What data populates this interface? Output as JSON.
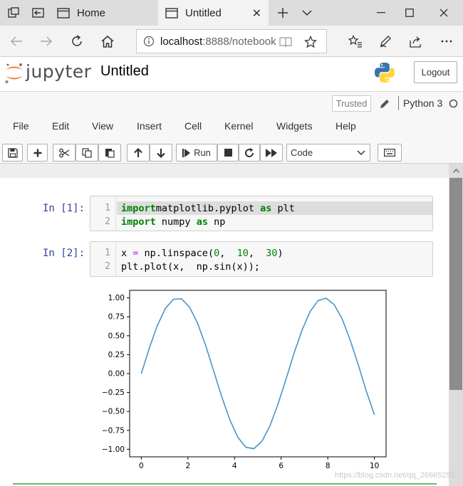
{
  "browser": {
    "tabs": [
      {
        "label": "Home",
        "active": false
      },
      {
        "label": "Untitled",
        "active": true
      }
    ],
    "address": {
      "host": "localhost",
      "path": ":8888/notebook"
    }
  },
  "jupyter": {
    "logo_text": "jupyter",
    "notebook_title": "Untitled",
    "logout_label": "Logout",
    "trusted_label": "Trusted",
    "kernel_label": "Python 3",
    "menu": [
      "File",
      "Edit",
      "View",
      "Insert",
      "Cell",
      "Kernel",
      "Widgets",
      "Help"
    ],
    "toolbar": {
      "run_label": "Run",
      "cell_type": "Code"
    }
  },
  "cells": [
    {
      "prompt": "In  [1]:",
      "lines": [
        {
          "n": "1",
          "tokens": [
            [
              "kw",
              "import"
            ],
            [
              "",
              "matplotlib.pyplot "
            ],
            [
              "kw",
              "as"
            ],
            [
              "",
              " plt"
            ]
          ]
        },
        {
          "n": "2",
          "tokens": [
            [
              "kw",
              "import"
            ],
            [
              "",
              " numpy "
            ],
            [
              "kw",
              "as"
            ],
            [
              "",
              " np"
            ]
          ]
        }
      ]
    },
    {
      "prompt": "In  [2]:",
      "lines": [
        {
          "n": "1",
          "tokens": [
            [
              "",
              "x "
            ],
            [
              "op",
              "="
            ],
            [
              "",
              " np.linspace("
            ],
            [
              "num",
              "0"
            ],
            [
              "",
              ",  "
            ],
            [
              "num",
              "10"
            ],
            [
              "",
              ",  "
            ],
            [
              "num",
              "30"
            ],
            [
              "",
              ")"
            ]
          ]
        },
        {
          "n": "2",
          "tokens": [
            [
              "",
              "plt.plot(x,  np.sin(x));"
            ]
          ]
        }
      ]
    }
  ],
  "chart_data": {
    "type": "line",
    "x": [
      0,
      0.345,
      0.69,
      1.034,
      1.379,
      1.724,
      2.069,
      2.414,
      2.759,
      3.103,
      3.448,
      3.793,
      4.138,
      4.483,
      4.828,
      5.172,
      5.517,
      5.862,
      6.207,
      6.552,
      6.897,
      7.241,
      7.586,
      7.931,
      8.276,
      8.621,
      8.966,
      9.31,
      9.655,
      10
    ],
    "y": [
      0,
      0.338,
      0.636,
      0.86,
      0.982,
      0.988,
      0.878,
      0.665,
      0.372,
      0.038,
      -0.304,
      -0.607,
      -0.84,
      -0.974,
      -0.993,
      -0.895,
      -0.693,
      -0.405,
      -0.075,
      0.269,
      0.576,
      0.819,
      0.966,
      0.996,
      0.911,
      0.719,
      0.437,
      0.113,
      -0.234,
      -0.544
    ],
    "xlim": [
      -0.5,
      10.5
    ],
    "ylim": [
      -1.1,
      1.1
    ],
    "xticks": [
      "0",
      "2",
      "4",
      "6",
      "8",
      "10"
    ],
    "xtick_values": [
      0,
      2,
      4,
      6,
      8,
      10
    ],
    "yticks": [
      "1.00",
      "0.75",
      "0.50",
      "0.25",
      "0.00",
      "−0.25",
      "−0.50",
      "−0.75",
      "−1.00"
    ],
    "ytick_values": [
      1,
      0.75,
      0.5,
      0.25,
      0,
      -0.25,
      -0.5,
      -0.75,
      -1
    ],
    "line_color": "#4c93c6",
    "grid": false
  },
  "watermark": "https://blog.csdn.net/qq_26665293"
}
